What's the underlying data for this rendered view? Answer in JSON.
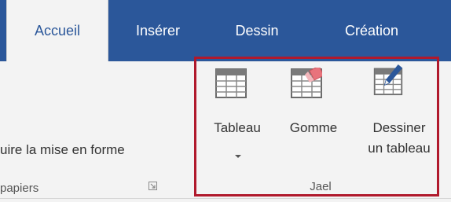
{
  "tabs": [
    {
      "label": "Accueil",
      "active": true
    },
    {
      "label": "Insérer",
      "active": false
    },
    {
      "label": "Dessin",
      "active": false
    },
    {
      "label": "Création",
      "active": false
    }
  ],
  "clipboard": {
    "partial_command": "uire la mise en forme",
    "partial_group_label": "papiers"
  },
  "table_group": {
    "label": "Jael",
    "commands": {
      "tableau": "Tableau",
      "gomme": "Gomme",
      "dessiner_line1": "Dessiner",
      "dessiner_line2": "un tableau"
    }
  },
  "colors": {
    "ribbon_blue": "#2b579a",
    "ribbon_bg": "#f3f3f3",
    "highlight_red": "#b0192c",
    "eraser_pink": "#e8737c",
    "pencil_blue": "#2b579a"
  }
}
